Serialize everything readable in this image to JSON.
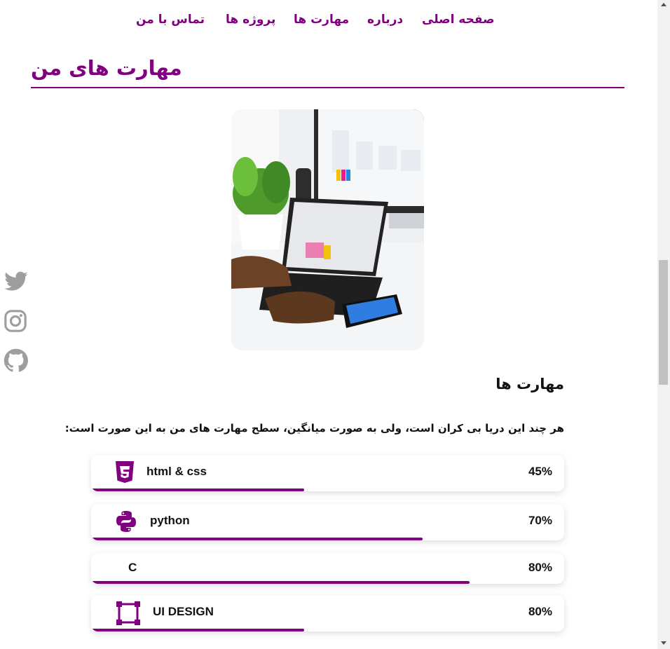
{
  "nav": {
    "items": [
      {
        "label": "صفحه اصلی"
      },
      {
        "label": "درباره"
      },
      {
        "label": "مهارت ها"
      },
      {
        "label": "پروژه ها"
      },
      {
        "label": "تماس با من"
      }
    ]
  },
  "section": {
    "title": "مهارت های من"
  },
  "hero": {
    "icon": "laptop-workspace-photo"
  },
  "social": [
    {
      "icon": "twitter-icon"
    },
    {
      "icon": "instagram-icon"
    },
    {
      "icon": "github-icon"
    }
  ],
  "skills": {
    "heading": "مهارت ها",
    "lead": "هر چند این دریا بی کران است، ولی به صورت میانگین، سطح مهارت های من به این صورت است:",
    "items": [
      {
        "name": "html & css",
        "percent": "45%",
        "icon": "css3-icon",
        "bar_fill": 0.45
      },
      {
        "name": "python",
        "percent": "70%",
        "icon": "python-icon",
        "bar_fill": 0.7
      },
      {
        "name": "C",
        "percent": "80%",
        "icon": "",
        "bar_fill": 0.8
      },
      {
        "name": "UI DESIGN",
        "percent": "80%",
        "icon": "vector-square-icon",
        "bar_fill": 0.45
      }
    ]
  },
  "colors": {
    "accent": "#800080",
    "social_gray": "#9e9e9e"
  }
}
